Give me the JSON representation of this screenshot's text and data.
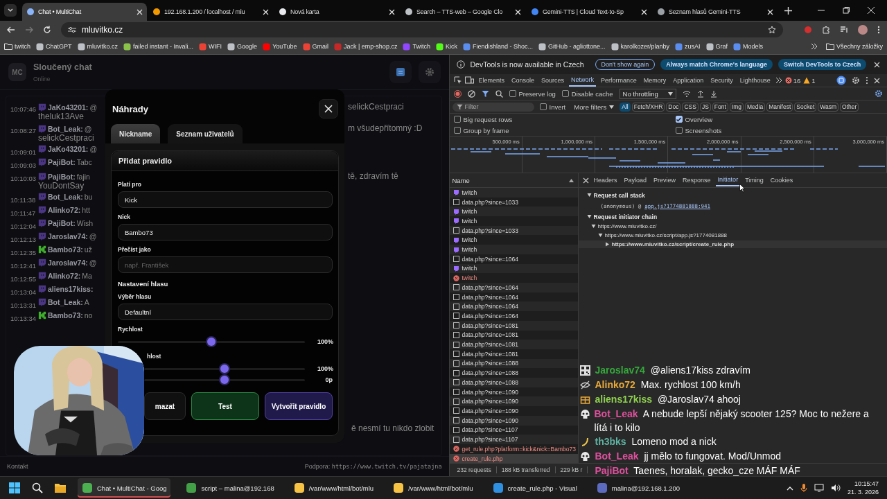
{
  "browser": {
    "tabs": [
      {
        "title": "Chat • MultiChat",
        "selected": true,
        "kind": "chat"
      },
      {
        "title": "192.168.1.200 / localhost / mlu",
        "selected": false,
        "kind": "db"
      },
      {
        "title": "Nová karta",
        "selected": false,
        "kind": "globe"
      },
      {
        "title": "Search – TTS-web – Google Clo",
        "selected": false,
        "kind": "gear"
      },
      {
        "title": "Gemini-TTS | Cloud Text-to-Sp",
        "selected": false,
        "kind": "cloud"
      },
      {
        "title": "Seznam hlasů Gemini-TTS",
        "selected": false,
        "kind": "page"
      }
    ],
    "address": "mluvitko.cz",
    "bookmarks": [
      {
        "label": "twitch",
        "kind": "folder"
      },
      {
        "label": "ChatGPT",
        "kind": "site"
      },
      {
        "label": "mluvitko.cz",
        "kind": "site"
      },
      {
        "label": "failed instant - Invali...",
        "kind": "game"
      },
      {
        "label": "WIFI",
        "kind": "mail"
      },
      {
        "label": "Google",
        "kind": "site"
      },
      {
        "label": "YouTube",
        "kind": "video"
      },
      {
        "label": "Gmail",
        "kind": "mail"
      },
      {
        "label": "Jack | emp-shop.cz",
        "kind": "shop"
      },
      {
        "label": "Twitch",
        "kind": "twitch"
      },
      {
        "label": "Kick",
        "kind": "kick"
      },
      {
        "label": "Fiendishland - Shoc...",
        "kind": "blue"
      },
      {
        "label": "GitHub - agliottone...",
        "kind": "site"
      },
      {
        "label": "karolkozer/planby",
        "kind": "site"
      },
      {
        "label": "zusAI",
        "kind": "blue"
      },
      {
        "label": "Graf",
        "kind": "site"
      },
      {
        "label": "Models",
        "kind": "blue"
      }
    ],
    "all_bookmarks": "Všechny záložky"
  },
  "page": {
    "avatar": "MC",
    "title": "Sloučený chat",
    "status": "Online",
    "messages": [
      {
        "time": "10:07:46",
        "kind": "twitch",
        "name": "JaKo43201:",
        "text": "@",
        "right": "selickCestpraci",
        "continued": "theluk13Ave"
      },
      {
        "time": "10:08:27",
        "kind": "twitch",
        "name": "Bot_Leak:",
        "text": "@",
        "right": "m všudepřítomný :D",
        "continued": "selickCestpraci"
      },
      {
        "time": "10:09:01",
        "kind": "twitch",
        "name": "JaKo43201:",
        "text": "@"
      },
      {
        "time": "10:09:03",
        "kind": "twitch",
        "name": "PajiBot:",
        "text": "Tabc"
      },
      {
        "time": "10:10:03",
        "kind": "twitch",
        "name": "PajiBot:",
        "text": "fajin",
        "right": "tě, zdravím tě",
        "continued": "YouDontSay"
      },
      {
        "time": "10:11:38",
        "kind": "twitch",
        "name": "Bot_Leak:",
        "text": "bu"
      },
      {
        "time": "10:11:47",
        "kind": "twitch",
        "name": "Alinko72:",
        "text": "htt"
      },
      {
        "time": "10:12:04",
        "kind": "twitch",
        "name": "PajiBot:",
        "text": "Wish"
      },
      {
        "time": "10:12:13",
        "kind": "twitch",
        "name": "Jaroslav74:",
        "text": "@"
      },
      {
        "time": "10:12:35",
        "kind": "kick",
        "name": "Bambo73:",
        "text": "už"
      },
      {
        "time": "10:12:41",
        "kind": "twitch",
        "name": "Jaroslav74:",
        "text": "@"
      },
      {
        "time": "10:12:55",
        "kind": "twitch",
        "name": "Alinko72:",
        "text": "Ma"
      },
      {
        "time": "10:13:04",
        "kind": "twitch",
        "name": "aliens17kiss:"
      },
      {
        "time": "10:13:31",
        "kind": "twitch",
        "name": "Bot_Leak:",
        "text": "A"
      },
      {
        "time": "10:13:34",
        "kind": "kick",
        "name": "Bambo73:",
        "text": "no"
      }
    ],
    "tail": "ě nesmí tu nikdo zlobit",
    "footer_left": "Kontakt",
    "support_label": "Podpora:",
    "support_url": "https://www.twitch.tv/pajatajna"
  },
  "dialog": {
    "title": "Náhrady",
    "tabs": [
      {
        "label": "Nickname",
        "selected": true
      },
      {
        "label": "Seznam uživatelů",
        "selected": false
      }
    ],
    "card_title": "Přidat pravidlo",
    "fields": [
      {
        "label": "Platí pro",
        "value": "Kick"
      },
      {
        "label": "Nick",
        "value": "Bambo73"
      },
      {
        "label": "Přečíst jako",
        "placeholder": "např. František"
      }
    ],
    "voice_section": "Nastavení hlasu",
    "voice": {
      "label": "Výběr hlasu",
      "value": "Defaultní"
    },
    "sliders": [
      {
        "label": "Rychlost",
        "level": 0.5,
        "reading": "100%"
      },
      {
        "label": "hlost",
        "level": 0.5,
        "reading": "100%"
      },
      {
        "level": 0.5,
        "reading": "0p"
      }
    ],
    "buttons": [
      {
        "label": "mazat",
        "kind": "delete"
      },
      {
        "label": "Test",
        "kind": "test"
      },
      {
        "label": "Vytvořit pravidlo",
        "kind": "create"
      }
    ]
  },
  "devtools": {
    "banner": {
      "text": "DevTools is now available in Czech",
      "buttons": [
        {
          "label": "Don't show again",
          "kind": "outline"
        },
        {
          "label": "Always match Chrome's language",
          "kind": "filled"
        },
        {
          "label": "Switch DevTools to Czech",
          "kind": "filled"
        }
      ]
    },
    "tabs": [
      {
        "label": "Elements",
        "selected": false
      },
      {
        "label": "Console",
        "selected": false
      },
      {
        "label": "Sources",
        "selected": false
      },
      {
        "label": "Network",
        "selected": true
      },
      {
        "label": "Performance",
        "selected": false
      },
      {
        "label": "Memory",
        "selected": false
      },
      {
        "label": "Application",
        "selected": false
      },
      {
        "label": "Security",
        "selected": false
      },
      {
        "label": "Lighthouse",
        "selected": false
      }
    ],
    "errors": "16",
    "warnings": "1",
    "preserve_log": {
      "label": "Preserve log",
      "checked": false
    },
    "disable_cache": {
      "label": "Disable cache",
      "checked": false
    },
    "throttling": "No throttling",
    "filter_placeholder": "Filter",
    "invert": {
      "label": "Invert",
      "checked": false
    },
    "more_filters": "More filters",
    "types": [
      {
        "label": "All",
        "selected": true
      },
      {
        "label": "Fetch/XHR",
        "selected": false
      },
      {
        "label": "Doc",
        "selected": false
      },
      {
        "label": "CSS",
        "selected": false
      },
      {
        "label": "JS",
        "selected": false
      },
      {
        "label": "Font",
        "selected": false
      },
      {
        "label": "Img",
        "selected": false
      },
      {
        "label": "Media",
        "selected": false
      },
      {
        "label": "Manifest",
        "selected": false
      },
      {
        "label": "Socket",
        "selected": false
      },
      {
        "label": "Wasm",
        "selected": false
      },
      {
        "label": "Other",
        "selected": false
      }
    ],
    "options": [
      {
        "label": "Big request rows",
        "checked": false
      },
      {
        "label": "Group by frame",
        "checked": false
      },
      {
        "label": "Overview",
        "checked": true
      },
      {
        "label": "Screenshots",
        "checked": false
      }
    ],
    "overview_ticks": [
      "500,000 ms",
      "1,000,000 ms",
      "1,500,000 ms",
      "2,000,000 ms",
      "2,500,000 ms",
      "3,000,000 ms"
    ],
    "name_header": "Name",
    "requests": [
      {
        "name": "twitch",
        "kind": "socket",
        "selected": false
      },
      {
        "name": "data.php?since=1033",
        "kind": "doc",
        "selected": false
      },
      {
        "name": "twitch",
        "kind": "socket",
        "selected": false
      },
      {
        "name": "twitch",
        "kind": "socket",
        "selected": false
      },
      {
        "name": "data.php?since=1033",
        "kind": "doc",
        "selected": false
      },
      {
        "name": "twitch",
        "kind": "socket",
        "selected": false
      },
      {
        "name": "twitch",
        "kind": "socket",
        "selected": false
      },
      {
        "name": "data.php?since=1064",
        "kind": "doc",
        "selected": false
      },
      {
        "name": "twitch",
        "kind": "socket",
        "selected": false
      },
      {
        "name": "twitch",
        "kind": "error",
        "selected": false
      },
      {
        "name": "data.php?since=1064",
        "kind": "doc",
        "selected": false
      },
      {
        "name": "data.php?since=1064",
        "kind": "doc",
        "selected": false
      },
      {
        "name": "data.php?since=1064",
        "kind": "doc",
        "selected": false
      },
      {
        "name": "data.php?since=1064",
        "kind": "doc",
        "selected": false
      },
      {
        "name": "data.php?since=1081",
        "kind": "doc",
        "selected": false
      },
      {
        "name": "data.php?since=1081",
        "kind": "doc",
        "selected": false
      },
      {
        "name": "data.php?since=1081",
        "kind": "doc",
        "selected": false
      },
      {
        "name": "data.php?since=1081",
        "kind": "doc",
        "selected": false
      },
      {
        "name": "data.php?since=1088",
        "kind": "doc",
        "selected": false
      },
      {
        "name": "data.php?since=1088",
        "kind": "doc",
        "selected": false
      },
      {
        "name": "data.php?since=1088",
        "kind": "doc",
        "selected": false
      },
      {
        "name": "data.php?since=1090",
        "kind": "doc",
        "selected": false
      },
      {
        "name": "data.php?since=1090",
        "kind": "doc",
        "selected": false
      },
      {
        "name": "data.php?since=1090",
        "kind": "doc",
        "selected": false
      },
      {
        "name": "data.php?since=1090",
        "kind": "doc",
        "selected": false
      },
      {
        "name": "data.php?since=1107",
        "kind": "doc",
        "selected": false
      },
      {
        "name": "data.php?since=1107",
        "kind": "doc",
        "selected": false
      },
      {
        "name": "get_rule.php?platform=kick&nick=Bambo73",
        "kind": "error",
        "selected": false
      },
      {
        "name": "create_rule.php",
        "kind": "error",
        "selected": true
      }
    ],
    "detail_tabs": [
      {
        "label": "Headers",
        "selected": false
      },
      {
        "label": "Payload",
        "selected": false
      },
      {
        "label": "Preview",
        "selected": false
      },
      {
        "label": "Response",
        "selected": false
      },
      {
        "label": "Initiator",
        "selected": true
      },
      {
        "label": "Timing",
        "selected": false
      },
      {
        "label": "Cookies",
        "selected": false
      }
    ],
    "call_stack": {
      "title": "Request call stack",
      "expanded": true,
      "prefix": "(anonymous) @",
      "link": "app.js?1774881888:941"
    },
    "initiator_chain": {
      "title": "Request initiator chain",
      "expanded": true,
      "children": [
        {
          "url": "https://www.mluvitko.cz/",
          "expanded": true,
          "selected": false,
          "children": [
            {
              "url": "https://www.mluvitko.cz/script/app.js?1774081888",
              "expanded": true,
              "selected": false,
              "children": [
                {
                  "url": "https://www.mluvitko.cz/script/create_rule.php",
                  "expanded": false,
                  "selected": true
                }
              ]
            }
          ]
        }
      ]
    },
    "status": [
      "232 requests",
      "188 kB transferred",
      "229 kB r"
    ]
  },
  "stream_chat": [
    {
      "kind": "pixel",
      "name": "Jaroslav74",
      "color": "#35a83b",
      "text": "@aliens17kiss zdravím"
    },
    {
      "kind": "hidden",
      "name": "Alinko72",
      "color": "#e8a93a",
      "text": "Max. rychlost 100 km/h"
    },
    {
      "kind": "box",
      "name": "aliens17kiss",
      "color": "#8fd14f",
      "text": "@Jaroslav74 ahooj"
    },
    {
      "kind": "skull",
      "name": "Bot_Leak",
      "color": "#e0509f",
      "text": "A nebude lepší nějaký scooter 125? Moc to nežere a lítá i to kilo"
    },
    {
      "kind": "banana",
      "name": "th3bks",
      "color": "#5fb3a3",
      "text": "Lomeno mod a nick"
    },
    {
      "kind": "skull",
      "name": "Bot_Leak",
      "color": "#e0509f",
      "text": "jj mělo to fungovat. Mod/Unmod"
    },
    {
      "name": "PajiBot",
      "color": "#e0509f",
      "text": "Taenes, horalak, gecko_cze MÁF MÁF"
    }
  ],
  "taskbar": {
    "apps": [
      {
        "label": "Chat • MultiChat - Goog",
        "kind": "chrome",
        "active": true
      },
      {
        "label": "script – malina@192.168",
        "kind": "sync",
        "active": false
      },
      {
        "label": "/var/www/html/bot/mlu",
        "kind": "notepad",
        "active": false
      },
      {
        "label": "/var/www/html/bot/mlu",
        "kind": "notepad",
        "active": false
      },
      {
        "label": "create_rule.php - Visual",
        "kind": "code",
        "active": false
      },
      {
        "label": "malina@192.168.1.200",
        "kind": "terminal",
        "active": false
      }
    ],
    "time": "10:15:47",
    "date": "21. 3. 2026"
  }
}
